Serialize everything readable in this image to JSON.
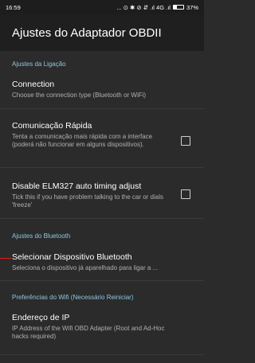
{
  "statusbar": {
    "time": "16:59",
    "icons_text": "... ⊙ ✱ ⊘ ⇵ .ıl 4G .ıl",
    "battery": "37%"
  },
  "appbar": {
    "title": "Ajustes do Adaptador OBDII"
  },
  "sections": {
    "connection": "Ajustes da Ligação",
    "bluetooth": "Ajustes do Bluetooth",
    "wifi": "Preferências do Wifi (Necessário Reiniciar)"
  },
  "prefs": {
    "connection": {
      "title": "Connection",
      "summary": "Choose the connection type (Bluetooth or WiFi)"
    },
    "fast": {
      "title": "Comunicação Rápida",
      "summary": "Tenta a comunicação mais rápida com a interface (poderá não funcionar em alguns dispositivos)."
    },
    "elm": {
      "title": "Disable ELM327 auto timing adjust",
      "summary": "Tick this if you have problem talking to the car or dials 'freeze'"
    },
    "bt_device": {
      "title": "Selecionar Dispositivo Bluetooth",
      "summary": "Seleciona o dispositivo já aparelhado para ligar a ..."
    },
    "ip": {
      "title": "Endereço de IP",
      "summary": "IP Address of the Wifi OBD Adapter (Root and Ad-Hoc hacks required)"
    }
  }
}
